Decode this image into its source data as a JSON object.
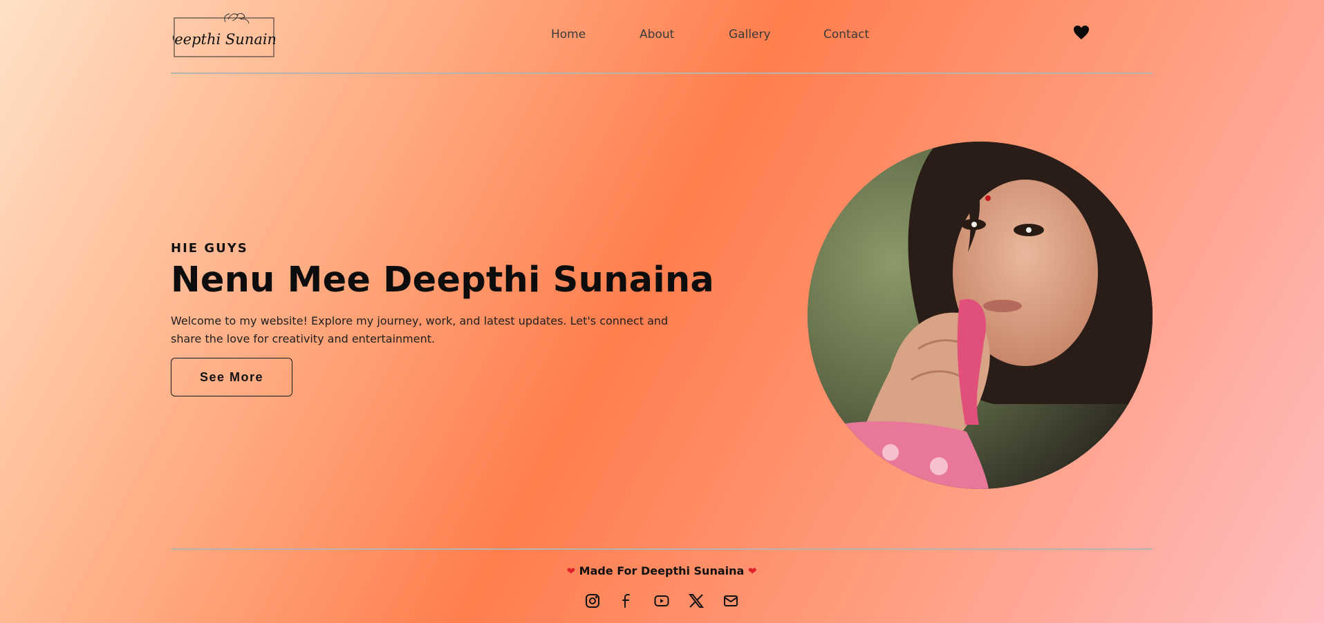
{
  "brand": {
    "logo_text": "Deepthi Sunaina"
  },
  "nav": {
    "items": [
      {
        "label": "Home"
      },
      {
        "label": "About"
      },
      {
        "label": "Gallery"
      },
      {
        "label": "Contact"
      }
    ],
    "heart_icon": "heart-icon"
  },
  "hero": {
    "eyebrow": "HIE GUYS",
    "title": "Nenu Mee Deepthi Sunaina",
    "description": "Welcome to my website! Explore my journey, work, and latest updates. Let's connect and share the love for creativity and entertainment.",
    "cta_label": "See More"
  },
  "footer": {
    "heart_left": "❤",
    "made_for": "Made For Deepthi Sunaina",
    "heart_right": "❤",
    "socials": [
      "instagram-icon",
      "facebook-icon",
      "youtube-icon",
      "x-icon",
      "mail-icon"
    ]
  },
  "colors": {
    "accent": "#ff7e4e",
    "heart": "#e0202a",
    "text": "#111111"
  }
}
